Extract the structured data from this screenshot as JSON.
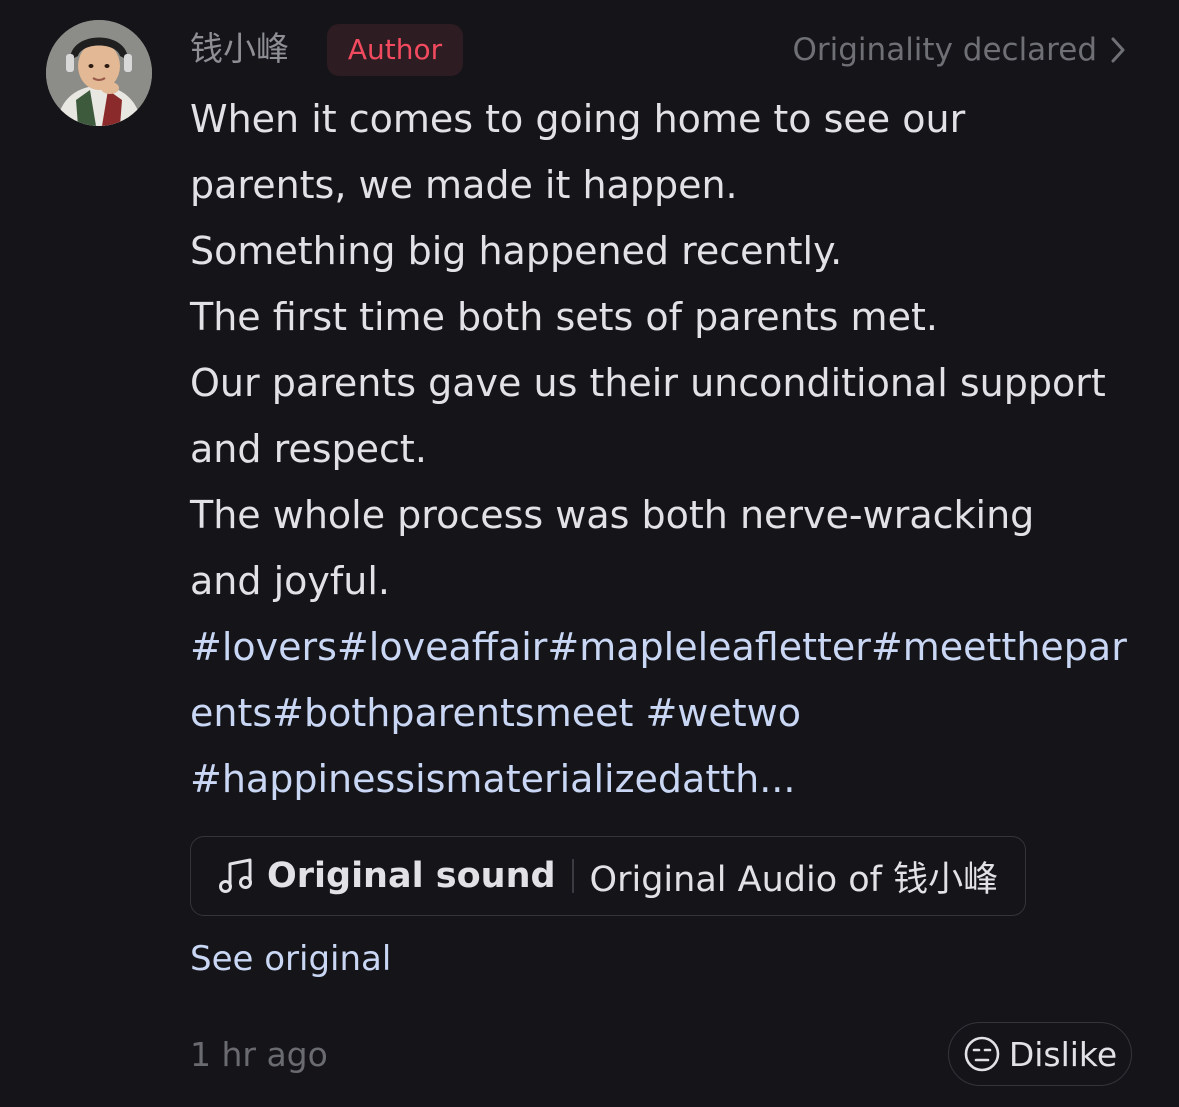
{
  "comment": {
    "username": "钱小峰",
    "author_badge": "Author",
    "originality_label": "Originality declared",
    "body_lines": [
      "When it comes to going home to see our",
      "parents, we made it happen.",
      "Something big happened recently.",
      "The first time both sets of parents met.",
      "Our parents gave us their unconditional support",
      "and respect.",
      "The whole process was both nerve-wracking",
      "and joyful."
    ],
    "hashtag_lines": [
      "#lovers#loveaffair#mapleleafletter#meetthepar",
      "ents#bothparentsmeet #wetwo",
      "#happinessismaterializedatth..."
    ],
    "sound": {
      "label": "Original sound",
      "title": "Original Audio of 钱小峰"
    },
    "see_original": "See original",
    "timestamp": "1 hr ago",
    "dislike_label": "Dislike"
  },
  "icons": {
    "chevron": "chevron-right-icon",
    "note": "music-note-icon",
    "dislike": "neutral-face-icon"
  },
  "colors": {
    "background": "#141419",
    "text": "#e1e1e6",
    "muted": "#6f6f76",
    "badge_text": "#f24a5e",
    "badge_bg": "#2d1c22",
    "hashtag": "#c9d7f5"
  }
}
